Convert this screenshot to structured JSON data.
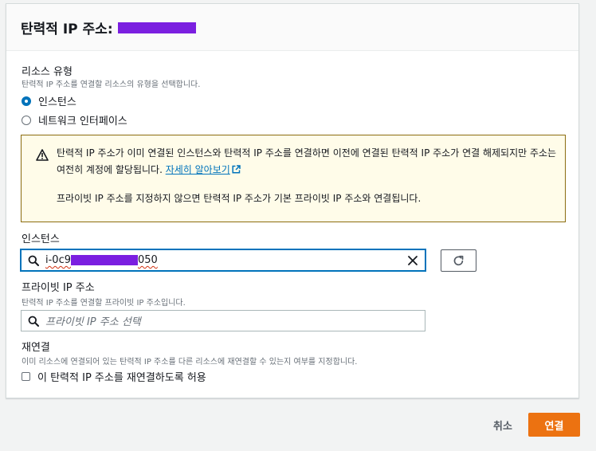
{
  "panel": {
    "title": "탄력적 IP 주소:"
  },
  "resource_type": {
    "label": "리소스 유형",
    "description": "탄력적 IP 주소를 연결할 리소스의 유형을 선택합니다.",
    "options": [
      {
        "label": "인스턴스",
        "checked": true
      },
      {
        "label": "네트워크 인터페이스",
        "checked": false
      }
    ]
  },
  "alert": {
    "icon": "warning-icon",
    "text_before_link": "탄력적 IP 주소가 이미 연결된 인스턴스와 탄력적 IP 주소를 연결하면 이전에 연결된 탄력적 IP 주소가 연결 해제되지만 주소는 여전히 계정에 할당됩니다. ",
    "link": "자세히 알아보기",
    "text2": "프라이빗 IP 주소를 지정하지 않으면 탄력적 IP 주소가 기본 프라이빗 IP 주소와 연결됩니다."
  },
  "instance": {
    "label": "인스턴스",
    "value_prefix": "i-0c9",
    "value_suffix": "050"
  },
  "private_ip": {
    "label": "프라이빗 IP 주소",
    "description": "탄력적 IP 주소를 연결할 프라이빗 IP 주소입니다.",
    "placeholder": "프라이빗 IP 주소 선택"
  },
  "reassociation": {
    "label": "재연결",
    "description": "이미 리소스에 연결되어 있는 탄력적 IP 주소를 다른 리소스에 재연결할 수 있는지 여부를 지정합니다.",
    "checkbox_label": "이 탄력적 IP 주소를 재연결하도록 허용",
    "checked": false
  },
  "footer": {
    "cancel_label": "취소",
    "submit_label": "연결"
  },
  "colors": {
    "accent": "#0073bb",
    "primary_button": "#ec7211",
    "alert_background": "#fffce9",
    "alert_border": "#8b6c10",
    "redaction": "#7b1fe0"
  }
}
